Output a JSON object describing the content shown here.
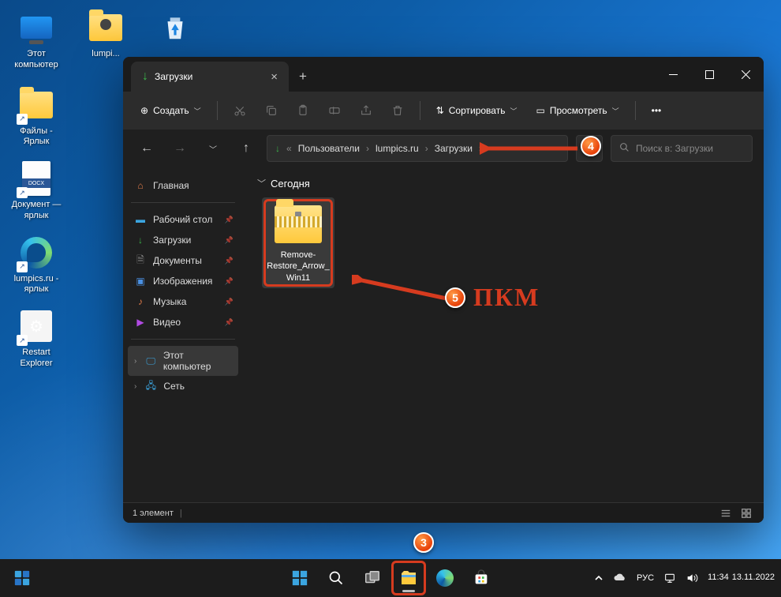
{
  "desktop_icons": {
    "this_pc": "Этот компьютер",
    "lumpics": "lumpi...",
    "recycle": "",
    "files_shortcut": "Файлы - Ярлык",
    "document_shortcut": "Документ — ярлык",
    "lumpics_shortcut": "lumpics.ru - ярлык",
    "restart_explorer": "Restart Explorer",
    "docx_band": "DOCX"
  },
  "explorer": {
    "tab_title": "Загрузки",
    "toolbar": {
      "create": "Создать",
      "sort": "Сортировать",
      "view": "Просмотреть",
      "create_icon": "⊕"
    },
    "breadcrumb": {
      "prefix": "«",
      "p1": "Пользователи",
      "p2": "lumpics.ru",
      "p3": "Загрузки"
    },
    "search_placeholder": "Поиск в: Загрузки",
    "sidebar": {
      "home": "Главная",
      "desktop": "Рабочий стол",
      "downloads": "Загрузки",
      "documents": "Документы",
      "pictures": "Изображения",
      "music": "Музыка",
      "videos": "Видео",
      "this_pc": "Этот компьютер",
      "network": "Сеть"
    },
    "content": {
      "group_today": "Сегодня",
      "file1_name": "Remove-Restore_Arrow_Win11"
    },
    "status": {
      "items": "1 элемент"
    }
  },
  "taskbar": {
    "lang": "РУС",
    "time": "11:34",
    "date": "13.11.2022"
  },
  "annotations": {
    "b3": "3",
    "b4": "4",
    "b5": "5",
    "pkm": "ПКМ"
  }
}
